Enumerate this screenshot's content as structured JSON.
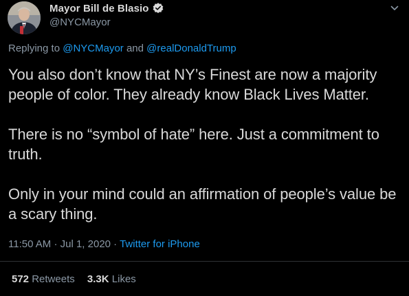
{
  "author": {
    "display_name": "Mayor Bill de Blasio",
    "handle": "@NYCMayor",
    "verified": true,
    "verified_icon": "verified-badge-icon"
  },
  "reply": {
    "prefix": "Replying to",
    "mention1": "@NYCMayor",
    "joiner": "and",
    "mention2": "@realDonaldTrump"
  },
  "body": {
    "paragraph1": "You also don’t know that NY’s Finest are now a majority people of color. They already know Black Lives Matter.",
    "paragraph2": "There is no “symbol of hate” here. Just a commitment to truth.",
    "paragraph3": "Only in your mind could an affirmation of people’s value be a scary thing."
  },
  "meta": {
    "time": "11:50 AM",
    "date": "Jul 1, 2020",
    "separator": "·",
    "source": "Twitter for iPhone"
  },
  "stats": {
    "retweets_count": "572",
    "retweets_label": "Retweets",
    "likes_count": "3.3K",
    "likes_label": "Likes"
  },
  "colors": {
    "background": "#000000",
    "text": "#d9d9d9",
    "secondary": "#8b98a5",
    "accent": "#1d9bf0",
    "divider": "#2f3336"
  }
}
